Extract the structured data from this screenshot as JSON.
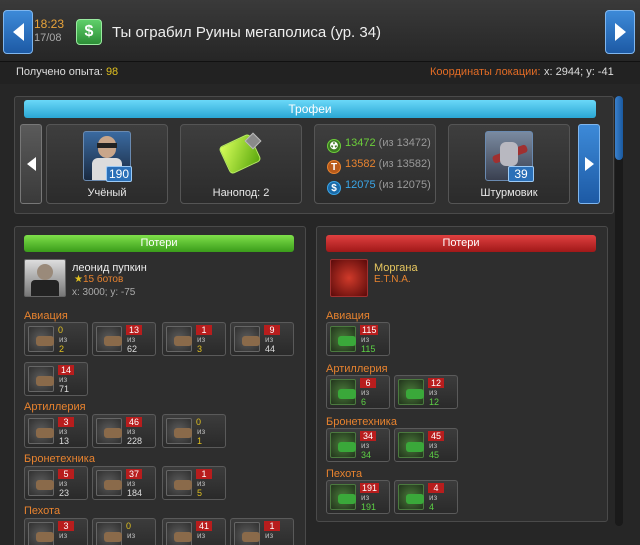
{
  "header": {
    "time": "18:23",
    "date": "17/08",
    "title": "Ты ограбил Руины мегаполиса (ур. 34)"
  },
  "info": {
    "xp_label": "Получено опыта:",
    "xp_value": "98",
    "coords_label": "Координаты локации:",
    "coords_value": "x: 2944; y: -41"
  },
  "trophies": {
    "title": "Трофеи",
    "items": [
      {
        "name": "Учёный",
        "level": "190",
        "icon": "scientist-portrait"
      },
      {
        "name": "Нанопод: 2",
        "icon": "nanopod-crystal"
      },
      {
        "name": "Штурмовик",
        "level": "39",
        "icon": "assault-aircraft"
      }
    ],
    "resources": [
      {
        "value": "13472",
        "total": "(из 13472)",
        "icon": "radiation-icon",
        "color": "#6ccf3a"
      },
      {
        "value": "13582",
        "total": "(из 13582)",
        "icon": "titanium-icon",
        "color": "#e8832f"
      },
      {
        "value": "12075",
        "total": "(из 12075)",
        "icon": "credits-icon",
        "color": "#3aa6e8"
      }
    ]
  },
  "of_word": "из",
  "left_losses": {
    "title": "Потери",
    "player": {
      "name": "леонид пупкин",
      "bots": "15 ботов",
      "coords": "x: 3000; y: -75"
    },
    "categories": [
      {
        "name": "Авиация",
        "units": [
          {
            "lost": "0",
            "total": "2"
          },
          {
            "lost": "13",
            "total": "62"
          },
          {
            "lost": "1",
            "total": "3"
          },
          {
            "lost": "9",
            "total": "44"
          },
          {
            "lost": "14",
            "total": "71"
          }
        ]
      },
      {
        "name": "Артиллерия",
        "units": [
          {
            "lost": "3",
            "total": "13"
          },
          {
            "lost": "46",
            "total": "228"
          },
          {
            "lost": "0",
            "total": "1"
          }
        ]
      },
      {
        "name": "Бронетехника",
        "units": [
          {
            "lost": "5",
            "total": "23"
          },
          {
            "lost": "37",
            "total": "184"
          },
          {
            "lost": "1",
            "total": "5"
          }
        ]
      },
      {
        "name": "Пехота",
        "units": [
          {
            "lost": "3",
            "total": ""
          },
          {
            "lost": "0",
            "total": ""
          },
          {
            "lost": "41",
            "total": ""
          },
          {
            "lost": "1",
            "total": ""
          }
        ]
      }
    ]
  },
  "right_losses": {
    "title": "Потери",
    "player": {
      "name": "Моргана",
      "sub": "E.T.N.A."
    },
    "categories": [
      {
        "name": "Авиация",
        "units": [
          {
            "lost": "115",
            "total": "115"
          }
        ]
      },
      {
        "name": "Артиллерия",
        "units": [
          {
            "lost": "6",
            "total": "6"
          },
          {
            "lost": "12",
            "total": "12"
          }
        ]
      },
      {
        "name": "Бронетехника",
        "units": [
          {
            "lost": "34",
            "total": "34"
          },
          {
            "lost": "45",
            "total": "45"
          }
        ]
      },
      {
        "name": "Пехота",
        "units": [
          {
            "lost": "191",
            "total": "191"
          },
          {
            "lost": "4",
            "total": "4"
          }
        ]
      }
    ]
  }
}
